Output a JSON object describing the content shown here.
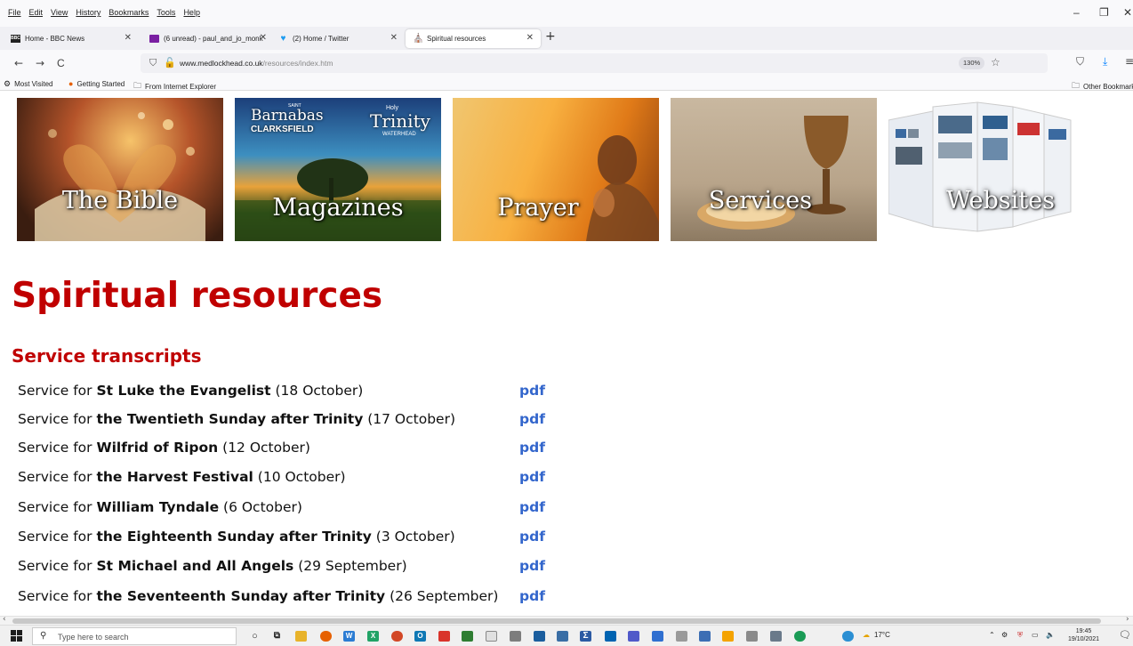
{
  "menubar": {
    "items": [
      "File",
      "Edit",
      "View",
      "History",
      "Bookmarks",
      "Tools",
      "Help"
    ],
    "minimize": "–",
    "restore": "❐",
    "close": "✕"
  },
  "tabs": [
    {
      "label": "Home - BBC News",
      "icon": "BBC",
      "close": "✕"
    },
    {
      "label": "(6 unread) - paul_and_jo_monk",
      "icon": "mail-icon",
      "close": "✕"
    },
    {
      "label": "(2) Home / Twitter",
      "icon": "twitter-icon",
      "close": "✕"
    },
    {
      "label": "Spiritual resources",
      "icon": "church-icon",
      "close": "✕"
    }
  ],
  "new_tab": "+",
  "nav": {
    "back": "←",
    "forward": "→",
    "reload": "C",
    "url_host": "www.medlockhead.co.uk",
    "url_path": "/resources/index.htm",
    "zoom": "130%",
    "star": "☆",
    "pocket": "⛉",
    "download": "⤓",
    "menu": "≡"
  },
  "bookmarks": {
    "items": [
      {
        "label": "Most Visited",
        "icon": "gear-icon"
      },
      {
        "label": "Getting Started",
        "icon": "firefox-icon"
      },
      {
        "label": "From Internet Explorer",
        "icon": "folder-icon"
      }
    ],
    "other": "Other Bookmarks"
  },
  "banners": [
    {
      "label": "The Bible"
    },
    {
      "label": "Magazines",
      "sub1": "Barnabas",
      "sub2": "CLARKSFIELD",
      "sub3": "Trinity",
      "sub4": "Holy",
      "sub5": "WATERHEAD",
      "sub6": "SAINT"
    },
    {
      "label": "Prayer"
    },
    {
      "label": "Services"
    },
    {
      "label": "Websites"
    }
  ],
  "page": {
    "title": "Spiritual resources",
    "section": "Service transcripts",
    "prefix": "Service for",
    "pdf_label": "pdf",
    "services": [
      {
        "name": "St Luke the Evangelist",
        "date": "(18 October)"
      },
      {
        "name": "the Twentieth Sunday after Trinity",
        "date": "(17 October)"
      },
      {
        "name": "Wilfrid of Ripon",
        "date": "(12 October)"
      },
      {
        "name": "the Harvest Festival",
        "date": "(10 October)"
      },
      {
        "name": "William Tyndale",
        "date": "(6 October)"
      },
      {
        "name": "the Eighteenth Sunday after Trinity",
        "date": "(3 October)"
      },
      {
        "name": "St Michael and All Angels",
        "date": "(29 September)"
      },
      {
        "name": "the Seventeenth Sunday after Trinity",
        "date": "(26 September)"
      }
    ]
  },
  "taskbar": {
    "search_placeholder": "Type here to search",
    "weather": "17°C",
    "time": "19:45",
    "date": "19/10/2021"
  },
  "colors": {
    "title_red": "#c00000",
    "link_blue": "#3366cc"
  }
}
